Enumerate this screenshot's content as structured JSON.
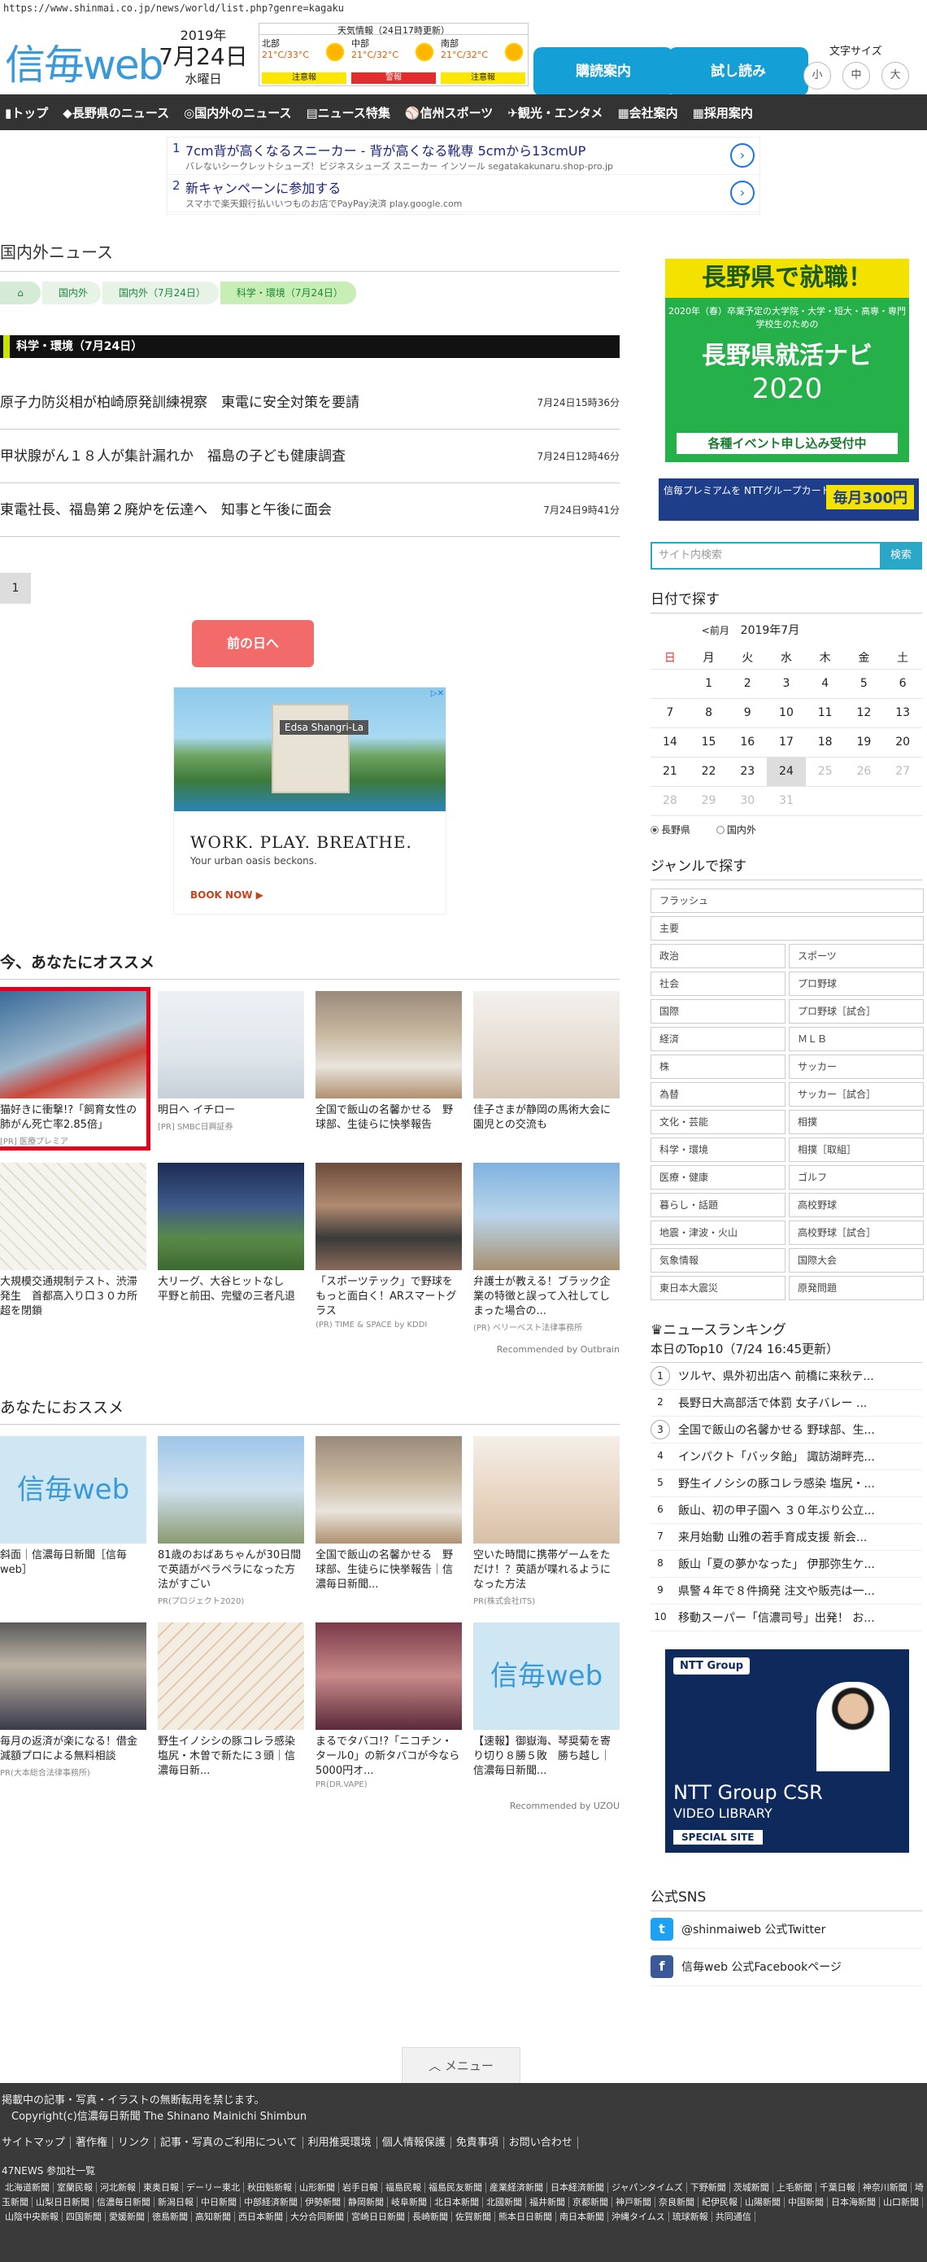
{
  "url": "https://www.shinmai.co.jp/news/world/list.php?genre=kagaku",
  "header": {
    "logo": "信毎web",
    "date": {
      "year": "2019年",
      "monthday": "7月24日",
      "weekday": "水曜日"
    },
    "weather": {
      "title": "天気情報（24日17時更新）",
      "areas": [
        {
          "name": "北部",
          "temp": "21°C/33°C",
          "alert": "注意報",
          "alert_color": "#fde700"
        },
        {
          "name": "中部",
          "temp": "21°C/32°C",
          "alert": "警報",
          "alert_color": "#e42c2c"
        },
        {
          "name": "南部",
          "temp": "21°C/32°C",
          "alert": "注意報",
          "alert_color": "#fde700"
        }
      ]
    },
    "buttons": {
      "subscribe": "購読案内",
      "trial": "試し読み"
    },
    "font_size": {
      "label": "文字サイズ",
      "small": "小",
      "medium": "中",
      "large": "大"
    }
  },
  "nav": [
    "トップ",
    "長野県のニュース",
    "国内外のニュース",
    "ニュース特集",
    "信州スポーツ",
    "観光・エンタメ",
    "会社案内",
    "採用案内"
  ],
  "text_ads": [
    {
      "num": "1",
      "title": "7cm背が高くなるスニーカー - 背が高くなる靴専 5cmから13cmUP",
      "sub": "バレないシークレットシューズ！ビジネスシューズ スニーカー インソール segatakakunaru.shop-pro.jp"
    },
    {
      "num": "2",
      "title": "新キャンペーンに参加する",
      "sub": "スマホで楽天銀行払いいつものお店でPayPay決済 play.google.com"
    }
  ],
  "main": {
    "section_title": "国内外ニュース",
    "breadcrumbs": [
      "国内外",
      "国内外（7月24日）",
      "科学・環境（7月24日）"
    ],
    "category": "科学・環境（7月24日）",
    "news": [
      {
        "title": "原子力防災相が柏崎原発訓練視察　東電に安全対策を要請",
        "time": "7月24日15時36分"
      },
      {
        "title": "甲状腺がん１８人が集計漏れか　福島の子ども健康調査",
        "time": "7月24日12時46分"
      },
      {
        "title": "東電社長、福島第２廃炉を伝達へ　知事と午後に面会",
        "time": "7月24日9時41分"
      }
    ],
    "page": "1",
    "prev_day": "前の日へ",
    "banner": {
      "brand": "Edsa Shangri-La",
      "headline": "WORK. PLAY. BREATHE.",
      "sub": "Your urban oasis beckons.",
      "cta": "BOOK NOW ▶"
    },
    "reco_title": "今、あなたにオススメ",
    "reco": [
      {
        "title": "猫好きに衝撃!?「飼育女性の肺がん死亡率2.85倍」",
        "src": "[PR] 医療プレミア"
      },
      {
        "title": "明日へ イチロー",
        "src": "[PR] SMBC日興証券"
      },
      {
        "title": "全国で飯山の名馨かせる　野球部、生徒らに快挙報告",
        "src": ""
      },
      {
        "title": "佳子さまが静岡の馬術大会に　園児との交流も",
        "src": ""
      },
      {
        "title": "大規模交通規制テスト、渋滞発生　首都高入り口３０カ所超を閉鎖",
        "src": ""
      },
      {
        "title": "大リーグ、大谷ヒットなし　平野と前田、完璧の三者凡退",
        "src": ""
      },
      {
        "title": "「スポーツテック」で野球をもっと面白く！ARスマートグラス",
        "src": "(PR) TIME & SPACE by KDDI"
      },
      {
        "title": "弁護士が教える！ブラック企業の特徴と誤って入社してしまった場合の...",
        "src": "(PR) ベリーベスト法律事務所"
      }
    ],
    "reco_credit": "Recommended by Outbrain",
    "reco2_title": "あなたにおススメ",
    "reco2": [
      {
        "title": "斜面｜信濃毎日新聞［信毎web］",
        "src": ""
      },
      {
        "title": "81歳のおばあちゃんが30日間で英語がペラペラになった方法がすごい",
        "src": "PR(プロジェクト2020)"
      },
      {
        "title": "全国で飯山の名馨かせる　野球部、生徒らに快挙報告｜信濃毎日新聞...",
        "src": ""
      },
      {
        "title": "空いた時間に携帯ゲームをただけ！？英語が喋れるようになった方法",
        "src": "PR(株式会社ITS)"
      },
      {
        "title": "毎月の返済が楽になる！借金減額プロによる無料相談",
        "src": "PR(大本総合法律事務所)"
      },
      {
        "title": "野生イノシシの豚コレラ感染　塩尻・木曽で新たに３頭｜信濃毎日新...",
        "src": ""
      },
      {
        "title": "まるでタバコ!?「ニコチン・タール0」の新タバコが今なら5000円オ...",
        "src": "PR(DR.VAPE)"
      },
      {
        "title": "【速報】御嶽海、琴奨菊を寄り切り８勝５敗　勝ち越し｜信濃毎日新聞...",
        "src": ""
      }
    ],
    "reco2_credit": "Recommended by UZOU"
  },
  "side": {
    "ad1": {
      "top": "長野県で就職！",
      "mid": "2020年（春）卒業予定の大学院・大学・短大・高専・専門学校生のための",
      "big": "長野県就活ナビ",
      "year": "2020",
      "bottom": "各種イベント申し込み受付中"
    },
    "ad2": {
      "text": "信毎プレミアムを NTTグループカードでお支払いすると",
      "amount": "毎月300円"
    },
    "search": {
      "placeholder": "サイト内検索",
      "button": "検索"
    },
    "calendar": {
      "title": "日付で探す",
      "prev": "<前月",
      "month": "2019年7月",
      "headers": [
        "日",
        "月",
        "火",
        "水",
        "木",
        "金",
        "土"
      ],
      "rows": [
        [
          "",
          "1",
          "2",
          "3",
          "4",
          "5",
          "6"
        ],
        [
          "7",
          "8",
          "9",
          "10",
          "11",
          "12",
          "13"
        ],
        [
          "14",
          "15",
          "16",
          "17",
          "18",
          "19",
          "20"
        ],
        [
          "21",
          "22",
          "23",
          "24",
          "25",
          "26",
          "27"
        ],
        [
          "28",
          "29",
          "30",
          "31",
          "",
          "",
          ""
        ]
      ],
      "radio": [
        "長野県",
        "国内外"
      ]
    },
    "genre_title": "ジャンルで探す",
    "genres_full": [
      "フラッシュ",
      "主要"
    ],
    "genres": [
      "政治",
      "スポーツ",
      "社会",
      "プロ野球",
      "国際",
      "プロ野球［試合］",
      "経済",
      "ＭＬＢ",
      "株",
      "サッカー",
      "為替",
      "サッカー［試合］",
      "文化・芸能",
      "相撲",
      "科学・環境",
      "相撲［取組］",
      "医療・健康",
      "ゴルフ",
      "暮らし・話題",
      "高校野球",
      "地震・津波・火山",
      "高校野球［試合］",
      "気象情報",
      "国際大会",
      "東日本大震災",
      "原発問題"
    ],
    "ranking_title": "ニュースランキング",
    "ranking_sub": "本日のTop10（7/24 16:45更新）",
    "ranking": [
      "ツルヤ、県外初出店へ 前橋に来秋テ...",
      "長野日大高部活で体罰 女子バレー ...",
      "全国で飯山の名馨かせる 野球部、生...",
      "インパクト「バッタ飴」 諏訪湖畔売...",
      "野生イノシシの豚コレラ感染 塩尻・...",
      "飯山、初の甲子園へ ３０年ぶり公立...",
      "来月始動 山雅の若手育成支援 新会...",
      "飯山「夏の夢かなった」 伊那弥生ケ...",
      "県警４年で８件摘発 注文や販売は一...",
      "移動スーパー「信濃司号」出発！ お..."
    ],
    "ad3": {
      "brand": "NTT Group",
      "t1": "NTT Group CSR",
      "t2": "VIDEO LIBRARY",
      "t3": "SPECIAL SITE"
    },
    "sns_title": "公式SNS",
    "sns": [
      "@shinmaiweb 公式Twitter",
      "信毎web 公式Facebookページ"
    ]
  },
  "menu_label": "メニュー",
  "footer": {
    "notice": "掲載中の記事・写真・イラストの無断転用を禁じます。",
    "copyright": "Copyright(c)信濃毎日新聞 The Shinano Mainichi Shimbun",
    "links": [
      "サイトマップ",
      "著作権",
      "リンク",
      "記事・写真のご利用について",
      "利用推奨環境",
      "個人情報保護",
      "免責事項",
      "お問い合わせ"
    ],
    "news47": "47NEWS 参加社一覧",
    "papers": [
      "北海道新聞",
      "室蘭民報",
      "河北新報",
      "東奥日報",
      "デーリー東北",
      "秋田魁新報",
      "山形新聞",
      "岩手日報",
      "福島民報",
      "福島民友新聞",
      "産業経済新聞",
      "日本経済新聞",
      "ジャパンタイムズ",
      "下野新聞",
      "茨城新聞",
      "上毛新聞",
      "千葉日報",
      "神奈川新聞",
      "埼玉新聞",
      "山梨日日新聞",
      "信濃毎日新聞",
      "新潟日報",
      "中日新聞",
      "中部経済新聞",
      "伊勢新聞",
      "静岡新聞",
      "岐阜新聞",
      "北日本新聞",
      "北國新聞",
      "福井新聞",
      "京都新聞",
      "神戸新聞",
      "奈良新聞",
      "紀伊民報",
      "山陽新聞",
      "中国新聞",
      "日本海新聞",
      "山口新聞",
      "山陰中央新報",
      "四国新聞",
      "愛媛新聞",
      "徳島新聞",
      "高知新聞",
      "西日本新聞",
      "大分合同新聞",
      "宮崎日日新聞",
      "長崎新聞",
      "佐賀新聞",
      "熊本日日新聞",
      "南日本新聞",
      "沖縄タイムス",
      "琉球新報",
      "共同通信"
    ]
  }
}
